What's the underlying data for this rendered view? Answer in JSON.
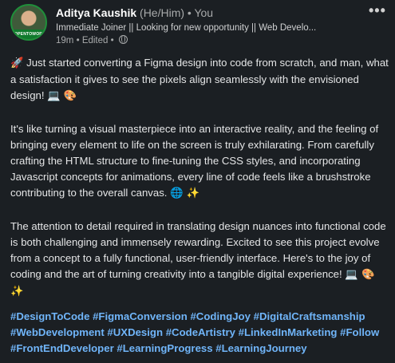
{
  "author": {
    "name": "Aditya Kaushik",
    "pronouns": "(He/Him)",
    "separator": "•",
    "relation": "You",
    "avatar_badge": "#OPENTOWORK",
    "headline": "Immediate Joiner || Looking for new opportunity || Web Develo...",
    "time": "19m",
    "edited": "Edited",
    "meta_separator": "•",
    "visibility_icon": "globe-icon"
  },
  "menu": {
    "more_label": "•••"
  },
  "post": {
    "paragraph1_icon": "🚀",
    "paragraph1": "Just started converting a Figma design into code from scratch, and man, what a satisfaction it gives to see the pixels align seamlessly with the envisioned design!",
    "paragraph1_emoji": "💻 🎨",
    "paragraph2": "It's like turning a visual masterpiece into an interactive reality, and the feeling of bringing every element to life on the screen is truly exhilarating. From carefully crafting the HTML structure to fine-tuning the CSS styles, and incorporating Javascript concepts for animations, every line of code feels like a brushstroke contributing to the overall canvas.",
    "paragraph2_emoji": "🌐 ✨",
    "paragraph3": "The attention to detail required in translating design nuances into functional code is both challenging and immensely rewarding. Excited to see this project evolve from a concept to a fully functional, user-friendly interface. Here's to the joy of coding and the art of turning creativity into a tangible digital experience!",
    "paragraph3_emoji": "💻 🎨 ✨"
  },
  "hashtags": [
    "#DesignToCode",
    "#FigmaConversion",
    "#CodingJoy",
    "#DigitalCraftsmanship",
    "#WebDevelopment",
    "#UXDesign",
    "#CodeArtistry",
    "#LinkedInMarketing",
    "#Follow",
    "#FrontEndDeveloper",
    "#LearningProgress",
    "#LearningJourney"
  ],
  "colors": {
    "background": "#1b1f23",
    "hashtag": "#70b5f9",
    "text": "#e4e5e6",
    "muted": "#a8aaab"
  }
}
